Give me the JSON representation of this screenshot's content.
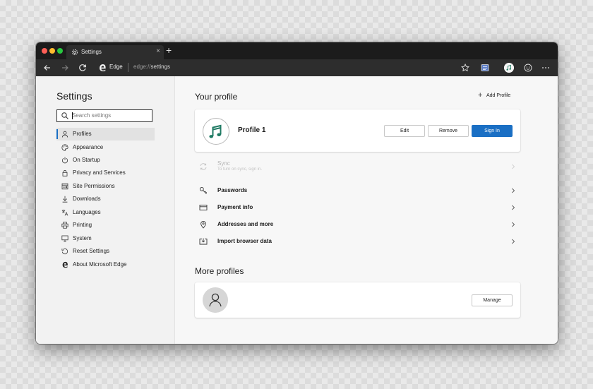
{
  "tab": {
    "title": "Settings",
    "close_glyph": "×",
    "new_tab_glyph": "+"
  },
  "toolbar": {
    "app_label": "Edge",
    "url_scheme": "edge://",
    "url_path": "settings"
  },
  "sidebar": {
    "title": "Settings",
    "search_placeholder": "Search settings",
    "items": [
      {
        "label": "Profiles",
        "icon": "person-icon",
        "active": true
      },
      {
        "label": "Appearance",
        "icon": "palette-icon"
      },
      {
        "label": "On Startup",
        "icon": "power-icon"
      },
      {
        "label": "Privacy and Services",
        "icon": "lock-icon"
      },
      {
        "label": "Site Permissions",
        "icon": "site-permissions-icon"
      },
      {
        "label": "Downloads",
        "icon": "download-icon"
      },
      {
        "label": "Languages",
        "icon": "languages-icon"
      },
      {
        "label": "Printing",
        "icon": "printer-icon"
      },
      {
        "label": "System",
        "icon": "system-icon"
      },
      {
        "label": "Reset Settings",
        "icon": "reset-icon"
      },
      {
        "label": "About Microsoft Edge",
        "icon": "edge-logo-icon"
      }
    ]
  },
  "main": {
    "your_profile_heading": "Your profile",
    "add_profile_label": "Add Profile",
    "profile": {
      "name": "Profile 1",
      "edit_label": "Edit",
      "remove_label": "Remove",
      "sign_in_label": "Sign In"
    },
    "sync": {
      "label": "Sync",
      "subtitle": "To turn on sync, sign in."
    },
    "rows": [
      {
        "label": "Passwords",
        "icon": "key-icon"
      },
      {
        "label": "Payment info",
        "icon": "card-icon"
      },
      {
        "label": "Addresses and more",
        "icon": "location-pin-icon"
      },
      {
        "label": "Import browser data",
        "icon": "import-icon"
      }
    ],
    "more_profiles_heading": "More profiles",
    "manage_label": "Manage"
  },
  "colors": {
    "accent": "#1a6fc4",
    "avatar_note": "#1f7a63"
  }
}
